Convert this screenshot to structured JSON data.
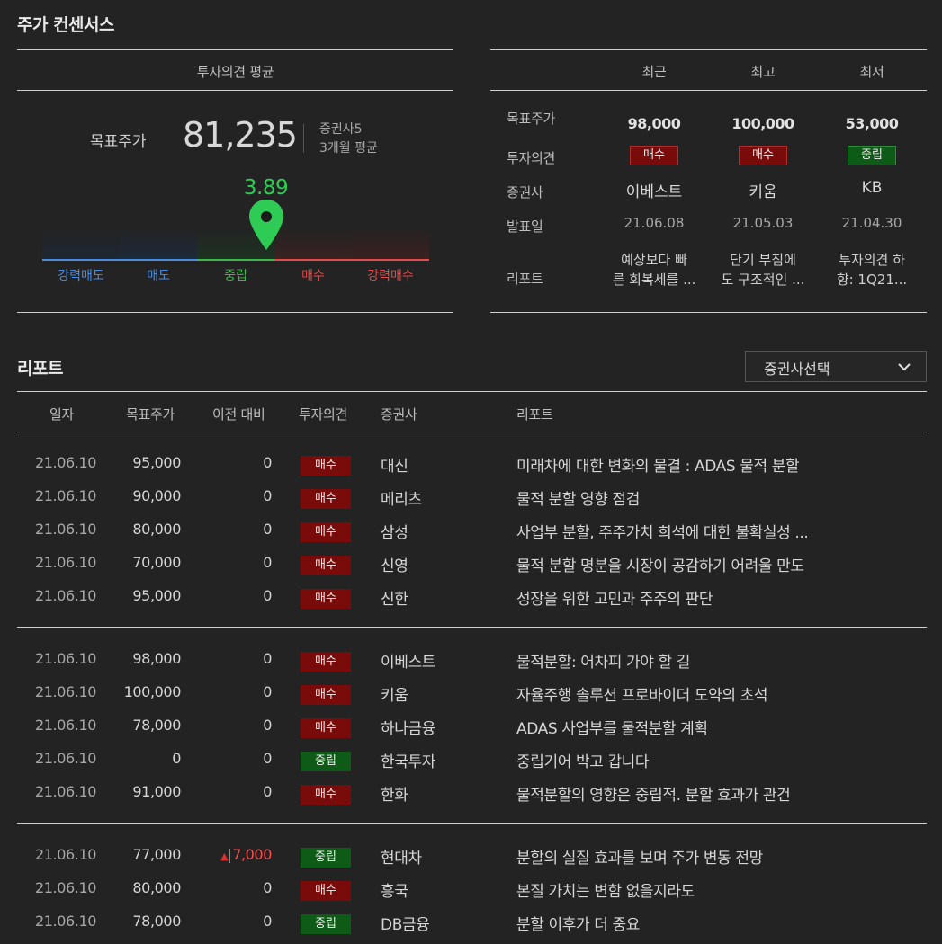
{
  "consensus": {
    "title": "주가 컨센서스",
    "avg_header": "투자의견 평균",
    "target_label": "목표주가",
    "target_value": "81,235",
    "brokers_count": "증권사5",
    "period": "3개월 평균",
    "score": "3.89",
    "score_fraction": 0.578,
    "gauge_labels": [
      "강력매도",
      "매도",
      "중립",
      "매수",
      "강력매수"
    ],
    "colors": {
      "strong_sell": "#4a8de0",
      "sell": "#4a8de0",
      "neutral": "#3cb84a",
      "buy": "#e04b4b",
      "strong_buy": "#e04b4b",
      "score": "#2ecc55"
    }
  },
  "compare": {
    "headers": [
      "최근",
      "최고",
      "최저"
    ],
    "row_labels": [
      "목표주가",
      "투자의견",
      "증권사",
      "발표일",
      "리포트"
    ],
    "columns": [
      {
        "price": "98,000",
        "opinion": "매수",
        "opinion_type": "buy",
        "broker": "이베스트",
        "date": "21.06.08",
        "report_l1": "예상보다 빠",
        "report_l2": "른 회복세를 ..."
      },
      {
        "price": "100,000",
        "opinion": "매수",
        "opinion_type": "buy",
        "broker": "키움",
        "date": "21.05.03",
        "report_l1": "단기 부침에",
        "report_l2": "도 구조적인 ..."
      },
      {
        "price": "53,000",
        "opinion": "중립",
        "opinion_type": "hold",
        "broker": "KB",
        "date": "21.04.30",
        "report_l1": "투자의견 하",
        "report_l2": "향: 1Q21..."
      }
    ]
  },
  "reports": {
    "title": "리포트",
    "select_label": "증권사선택",
    "headers": [
      "일자",
      "목표주가",
      "이전 대비",
      "투자의견",
      "증권사",
      "리포트"
    ],
    "rows": [
      {
        "date": "21.06.10",
        "price": "95,000",
        "change": "0",
        "opinion": "매수",
        "type": "buy",
        "broker": "대신",
        "title": "미래차에 대한 변화의 물결 : ADAS 물적 분할"
      },
      {
        "date": "21.06.10",
        "price": "90,000",
        "change": "0",
        "opinion": "매수",
        "type": "buy",
        "broker": "메리츠",
        "title": "물적 분할 영향 점검"
      },
      {
        "date": "21.06.10",
        "price": "80,000",
        "change": "0",
        "opinion": "매수",
        "type": "buy",
        "broker": "삼성",
        "title": "사업부 분할, 주주가치 희석에 대한 불확실성 ..."
      },
      {
        "date": "21.06.10",
        "price": "70,000",
        "change": "0",
        "opinion": "매수",
        "type": "buy",
        "broker": "신영",
        "title": "물적 분할 명분을 시장이 공감하기 어려울 만도"
      },
      {
        "date": "21.06.10",
        "price": "95,000",
        "change": "0",
        "opinion": "매수",
        "type": "buy",
        "broker": "신한",
        "title": "성장을 위한 고민과 주주의 판단"
      },
      {
        "date": "21.06.10",
        "price": "98,000",
        "change": "0",
        "opinion": "매수",
        "type": "buy",
        "broker": "이베스트",
        "title": "물적분할: 어차피 가야 할 길"
      },
      {
        "date": "21.06.10",
        "price": "100,000",
        "change": "0",
        "opinion": "매수",
        "type": "buy",
        "broker": "키움",
        "title": "자율주행 솔루션 프로바이더 도약의 초석"
      },
      {
        "date": "21.06.10",
        "price": "78,000",
        "change": "0",
        "opinion": "매수",
        "type": "buy",
        "broker": "하나금융",
        "title": "ADAS 사업부를 물적분할 계획"
      },
      {
        "date": "21.06.10",
        "price": "0",
        "change": "0",
        "opinion": "중립",
        "type": "hold",
        "broker": "한국투자",
        "title": "중립기어 박고 갑니다"
      },
      {
        "date": "21.06.10",
        "price": "91,000",
        "change": "0",
        "opinion": "매수",
        "type": "buy",
        "broker": "한화",
        "title": "물적분할의 영향은 중립적. 분할 효과가 관건"
      },
      {
        "date": "21.06.10",
        "price": "77,000",
        "change": "7,000",
        "change_up": true,
        "opinion": "중립",
        "type": "hold",
        "broker": "현대차",
        "title": "분할의 실질 효과를 보며 주가 변동 전망"
      },
      {
        "date": "21.06.10",
        "price": "80,000",
        "change": "0",
        "opinion": "매수",
        "type": "buy",
        "broker": "흥국",
        "title": "본질 가치는 변함 없을지라도"
      },
      {
        "date": "21.06.10",
        "price": "78,000",
        "change": "0",
        "opinion": "중립",
        "type": "hold",
        "broker": "DB금융",
        "title": "분할 이후가 더 중요"
      }
    ]
  }
}
